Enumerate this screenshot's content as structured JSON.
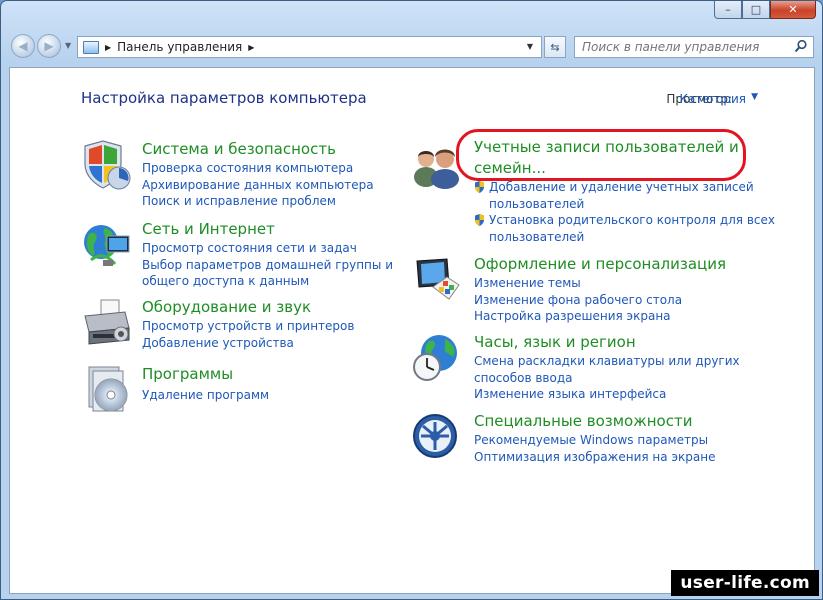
{
  "window": {
    "minimize_glyph": "–",
    "maximize_glyph": "□",
    "close_glyph": "✕"
  },
  "address_bar": {
    "path": "Панель управления"
  },
  "search": {
    "placeholder": "Поиск в панели управления"
  },
  "content": {
    "heading": "Настройка параметров компьютера",
    "view_by_label": "Просмотр:",
    "view_by_value": "Категория"
  },
  "categories_left": [
    {
      "icon": "shield-security-icon",
      "title": "Система и безопасность",
      "links": [
        "Проверка состояния компьютера",
        "Архивирование данных компьютера",
        "Поиск и исправление проблем"
      ]
    },
    {
      "icon": "network-globe-icon",
      "title": "Сеть и Интернет",
      "links": [
        "Просмотр состояния сети и задач",
        "Выбор параметров домашней группы и",
        "общего доступа к данным"
      ]
    },
    {
      "icon": "printer-icon",
      "title": "Оборудование и звук",
      "links": [
        "Просмотр устройств и принтеров",
        "Добавление устройства"
      ]
    },
    {
      "icon": "programs-disc-icon",
      "title": "Программы",
      "links": [
        "Удаление программ"
      ]
    }
  ],
  "categories_right": [
    {
      "icon": "users-icon",
      "title_line1": "Учетные записи пользователей и",
      "title_line2": "семейн...",
      "links": [
        "Добавление и удаление учетных записей",
        "пользователей",
        "Установка родительского контроля для всех",
        "пользователей"
      ]
    },
    {
      "icon": "appearance-monitor-icon",
      "title": "Оформление и персонализация",
      "links": [
        "Изменение темы",
        "Изменение фона рабочего стола",
        "Настройка разрешения экрана"
      ]
    },
    {
      "icon": "clock-globe-icon",
      "title": "Часы, язык и регион",
      "links": [
        "Смена раскладки клавиатуры или других",
        "способов ввода",
        "Изменение языка интерфейса"
      ]
    },
    {
      "icon": "ease-of-access-icon",
      "title": "Специальные возможности",
      "links": [
        "Рекомендуемые Windows параметры",
        "Оптимизация изображения на экране"
      ]
    }
  ],
  "watermark": "user-life.com",
  "colors": {
    "category_title": "#1e8d24",
    "link": "#1f58b8",
    "heading": "#1e3287",
    "highlight": "#e3141f"
  }
}
